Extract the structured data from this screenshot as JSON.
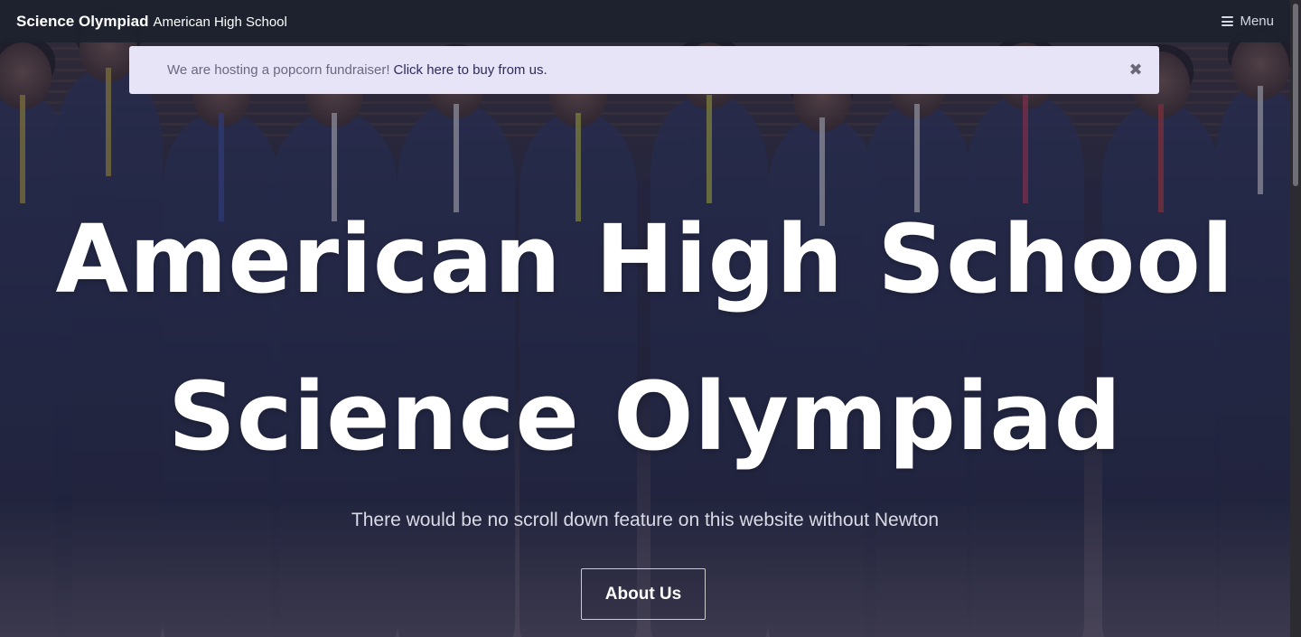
{
  "navbar": {
    "brand_strong": "Science Olympiad",
    "brand_light": "American High School",
    "menu_label": "Menu",
    "menu_icon": "hamburger-icon"
  },
  "alert": {
    "text": "We are hosting a popcorn fundraiser!",
    "link_text": "Click here to buy from us.",
    "close_icon": "close-icon",
    "close_glyph": "✖"
  },
  "hero": {
    "title_line1": "American High School",
    "title_line2": "Science Olympiad",
    "subtitle": "There would be no scroll down feature on this website without Newton",
    "cta_label": "About Us",
    "background_image": "team-group-photo"
  },
  "colors": {
    "navbar_bg": "#1c222e",
    "alert_bg": "#e7e4f8",
    "alert_link": "#2e2a5a",
    "hero_overlay": "#23243e"
  }
}
